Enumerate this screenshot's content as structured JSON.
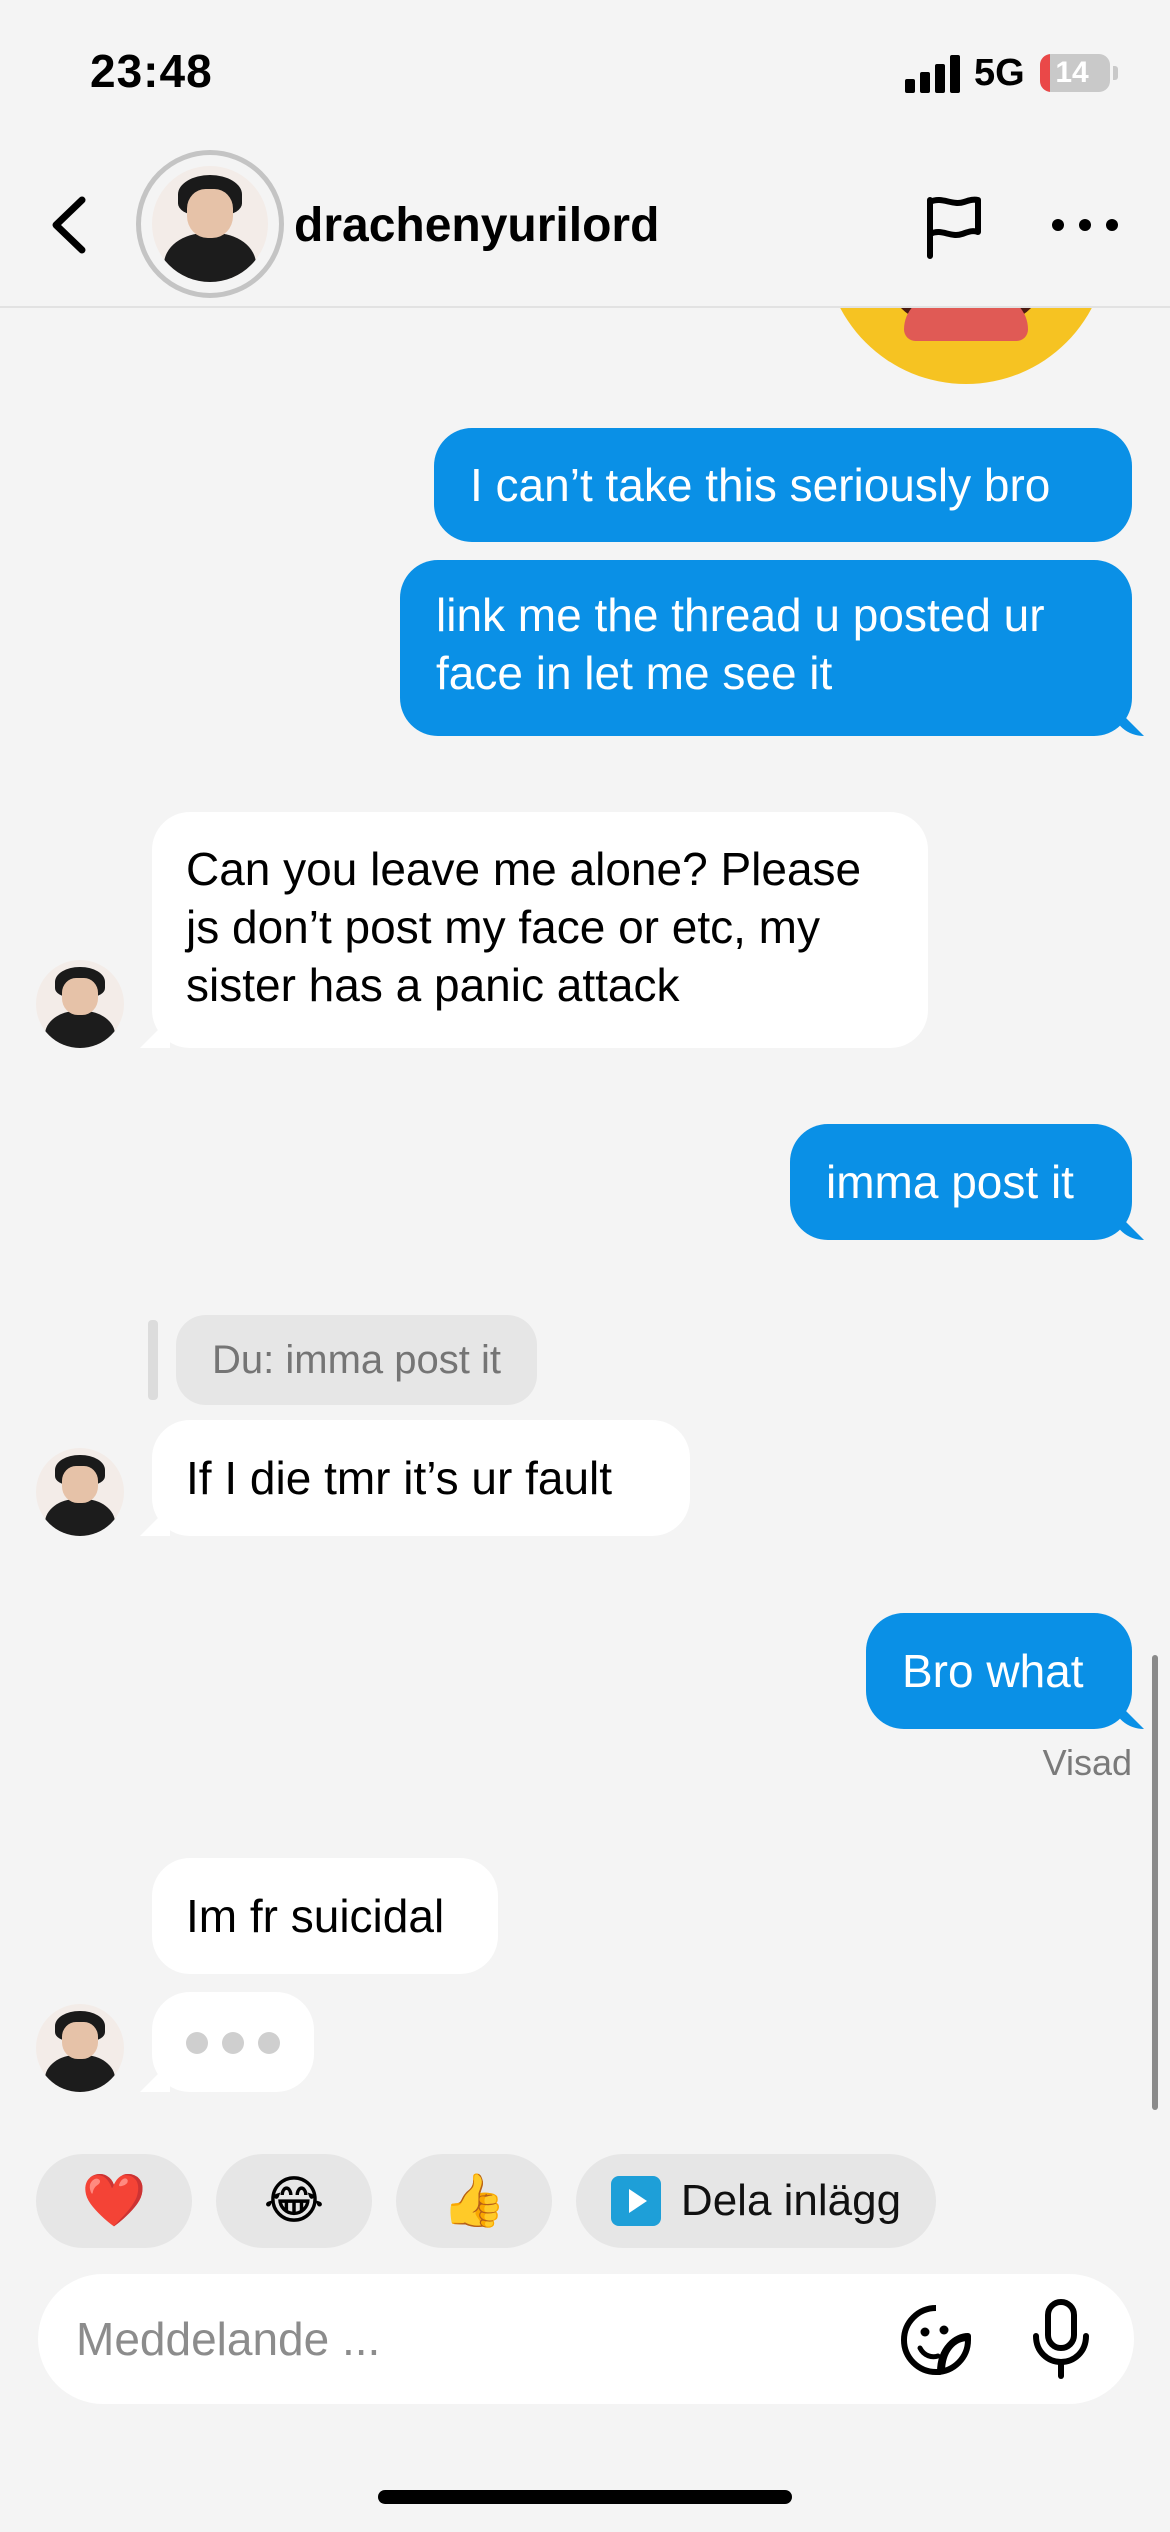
{
  "status": {
    "time": "23:48",
    "network": "5G",
    "battery": "14",
    "battery_level": 0.14
  },
  "header": {
    "username": "drachenyurilord"
  },
  "messages": {
    "m1": "I can’t take this seriously bro",
    "m2_line1": "link me the thread u posted ur",
    "m2_line2": "face in let me see it",
    "m3_line1": "Can you leave me alone? Please",
    "m3_line2": "js don’t post my face or etc, my",
    "m3_line3": "sister has a panic attack",
    "m4": "imma post it",
    "reply_quote": "Du: imma post it",
    "m5": "If I die tmr it’s ur fault",
    "m6": "Bro what",
    "seen": "Visad",
    "m7": "Im fr suicidal"
  },
  "quick_replies": {
    "heart": "❤️",
    "laugh": "😂",
    "thumbs": "👍",
    "share": "Dela inlägg"
  },
  "composer": {
    "placeholder": "Meddelande ..."
  },
  "icons": {
    "back": "chevron-left-icon",
    "flag": "flag-icon",
    "more": "more-horizontal-icon",
    "sticker": "sticker-icon",
    "mic": "microphone-icon",
    "share": "play-square-icon"
  },
  "colors": {
    "outgoing_bubble": "#0a90e6",
    "incoming_bubble": "#ffffff",
    "background": "#f4f4f4"
  }
}
